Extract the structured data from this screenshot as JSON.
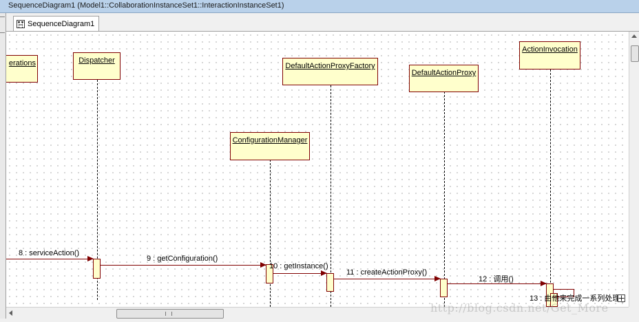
{
  "window": {
    "title": "SequenceDiagram1 (Model1::CollaborationInstanceSet1::InteractionInstanceSet1)"
  },
  "tab": {
    "label": "SequenceDiagram1",
    "icon": "sequence-diagram-icon"
  },
  "diagram": {
    "objects": [
      {
        "name": "erations"
      },
      {
        "name": "Dispatcher"
      },
      {
        "name": "DefaultActionProxyFactory"
      },
      {
        "name": "DefaultActionProxy"
      },
      {
        "name": "ActionInvocation"
      },
      {
        "name": "ConfigurationManager"
      }
    ],
    "messages": [
      {
        "label": "8 : serviceAction()"
      },
      {
        "label": "9 : getConfiguration()"
      },
      {
        "label": "10 : getInstance()"
      },
      {
        "label": "11 : createActionProxy()"
      },
      {
        "label": "12 : 调用()"
      },
      {
        "label": "13 : 由他来完成一系列处理()"
      }
    ]
  },
  "watermark": {
    "text": "http://blog.csdn.net/Get_More"
  },
  "colors": {
    "object_fill": "#ffffcc",
    "object_border": "#800000",
    "message_line": "#800000",
    "titlebar": "#b9d1ea"
  }
}
